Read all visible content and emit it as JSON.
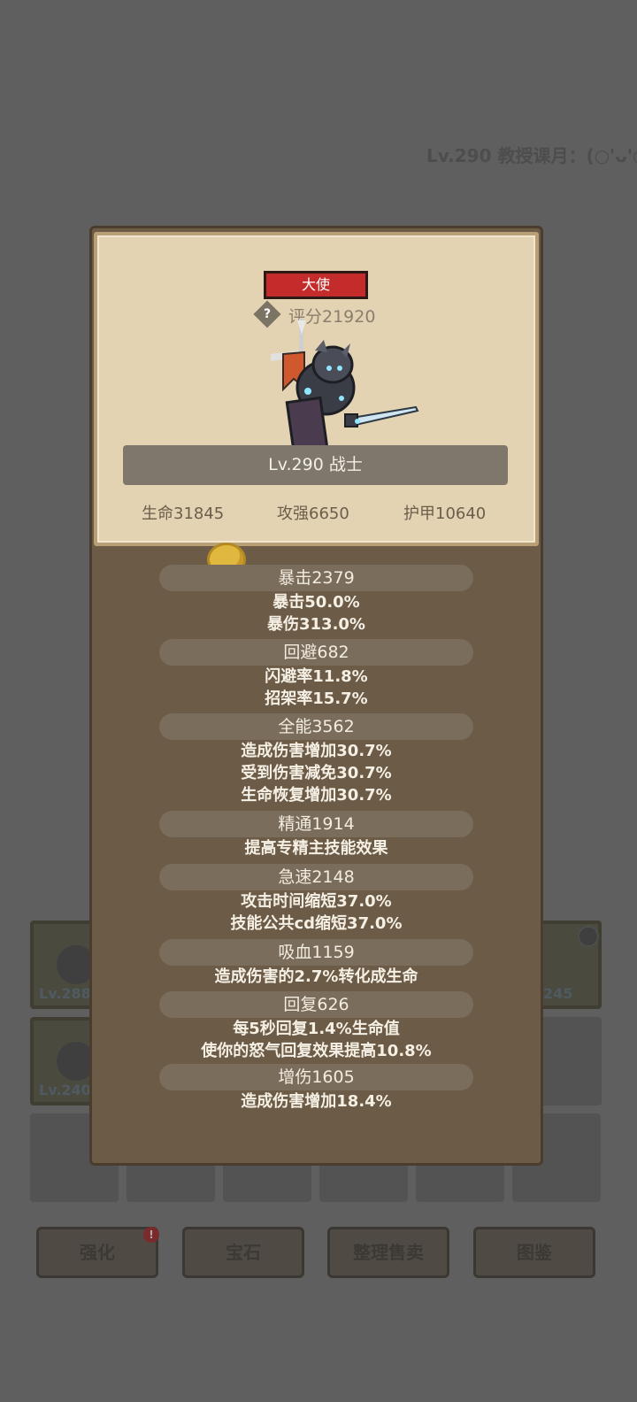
{
  "background": {
    "top_label": "Lv.290 教授课月：(○'ᴗ'○)",
    "slots": [
      {
        "level": "Lv.288"
      },
      {
        "level": "245"
      },
      {
        "level": "Lv.240"
      }
    ],
    "buttons": [
      {
        "label": "强化"
      },
      {
        "label": "宝石"
      },
      {
        "label": "整理售卖"
      },
      {
        "label": "图鉴"
      }
    ],
    "badge": "!"
  },
  "popup": {
    "rank": "大使",
    "help_glyph": "?",
    "score": "评分21920",
    "level_class": "Lv.290 战士",
    "base_stats": {
      "hp": "生命31845",
      "atk": "攻强6650",
      "armor": "护甲10640"
    },
    "sections": [
      {
        "header": "暴击2379",
        "details": [
          "暴击50.0%",
          "暴伤313.0%"
        ]
      },
      {
        "header": "回避682",
        "details": [
          "闪避率11.8%",
          "招架率15.7%"
        ]
      },
      {
        "header": "全能3562",
        "details": [
          "造成伤害增加30.7%",
          "受到伤害减免30.7%",
          "生命恢复增加30.7%"
        ]
      },
      {
        "header": "精通1914",
        "details": [
          "提高专精主技能效果"
        ]
      },
      {
        "header": "急速2148",
        "details": [
          "攻击时间缩短37.0%",
          "技能公共cd缩短37.0%"
        ]
      },
      {
        "header": "吸血1159",
        "details": [
          "造成伤害的2.7%转化成生命"
        ]
      },
      {
        "header": "回复626",
        "details": [
          "每5秒回复1.4%生命值",
          "使你的怒气回复效果提高10.8%"
        ]
      },
      {
        "header": "增伤1605",
        "details": [
          "造成伤害增加18.4%"
        ]
      }
    ]
  }
}
